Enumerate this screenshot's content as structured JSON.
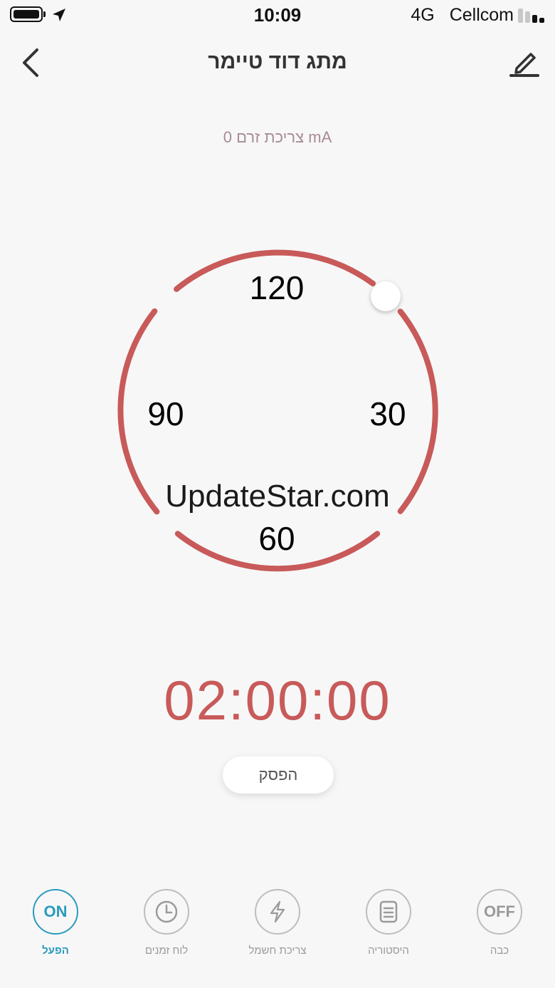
{
  "status_bar": {
    "time": "10:09",
    "network": "4G",
    "carrier": "Cellcom"
  },
  "header": {
    "title": "מתג דוד טיימר"
  },
  "current_draw": "צריכת זרם 0 mA",
  "dial": {
    "labels": {
      "top": "120",
      "right": "30",
      "bottom": "60",
      "left": "90"
    },
    "color": "#c85a5a"
  },
  "watermark": "UpdateStar.com",
  "countdown": "02:00:00",
  "stop_button": "הפסק",
  "bottom_nav": {
    "on": {
      "icon_text": "ON",
      "label": "הפעל"
    },
    "schedule": {
      "label": "לוח זמנים"
    },
    "power": {
      "label": "צריכת חשמל"
    },
    "history": {
      "label": "היסטוריה"
    },
    "off": {
      "icon_text": "OFF",
      "label": "כבה"
    }
  },
  "colors": {
    "accent": "#2a9bbd",
    "timer_red": "#c85a5a"
  }
}
